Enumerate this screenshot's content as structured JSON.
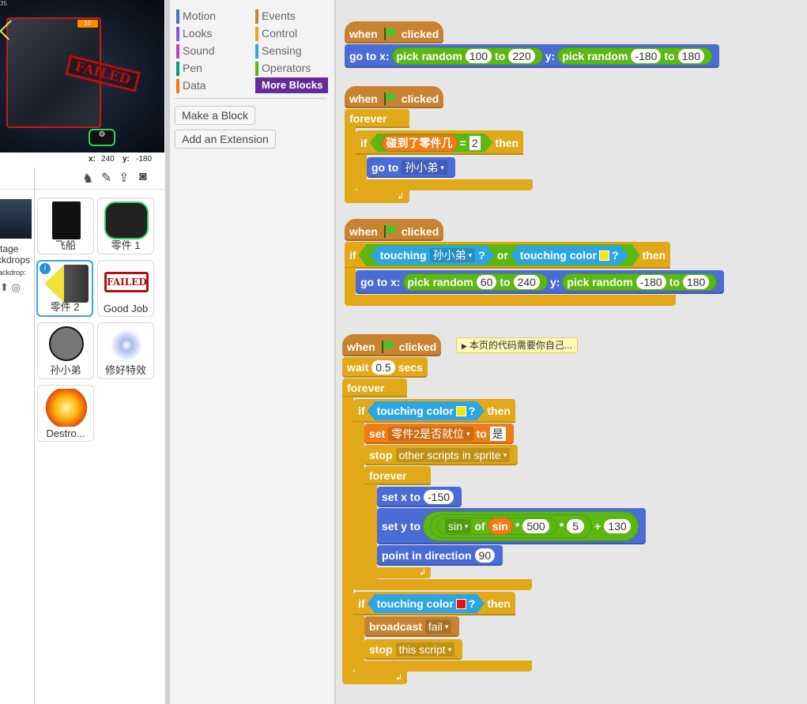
{
  "stage": {
    "counter": "35",
    "hud_value": "10",
    "failed_text": "FAILED",
    "x_label": "x:",
    "x_value": "240",
    "y_label": "y:",
    "y_value": "-180"
  },
  "stage_column": {
    "line1": "tage",
    "line2": "ckdrops",
    "line3": "ackdrop:"
  },
  "sprites": [
    {
      "name": "飞船"
    },
    {
      "name": "零件 1"
    },
    {
      "name": "零件 2"
    },
    {
      "name": "Good Job"
    },
    {
      "name": "孙小弟"
    },
    {
      "name": "修好特效"
    },
    {
      "name": "Destro..."
    }
  ],
  "palette": {
    "categories_left": [
      "Motion",
      "Looks",
      "Sound",
      "Pen",
      "Data"
    ],
    "categories_right": [
      "Events",
      "Control",
      "Sensing",
      "Operators",
      "More Blocks"
    ],
    "colors": {
      "Motion": "#4a6cd4",
      "Looks": "#8a55d7",
      "Sound": "#bb42c3",
      "Pen": "#0e9a6c",
      "Data": "#ee7d16",
      "Events": "#c88330",
      "Control": "#e1a91a",
      "Sensing": "#2ca5e2",
      "Operators": "#5cb712",
      "More Blocks": "#632d99"
    },
    "make_block": "Make a Block",
    "add_extension": "Add an Extension"
  },
  "scripts": {
    "when": "when",
    "clicked": "clicked",
    "go_to_x": "go to x:",
    "y": "y:",
    "pick_random": "pick random",
    "to": "to",
    "s1_a": "100",
    "s1_b": "220",
    "s1_c": "-180",
    "s1_d": "180",
    "forever": "forever",
    "if": "if",
    "then": "then",
    "touched_part": "碰到了零件几",
    "equals": "=",
    "eq_value": "2",
    "go_to": "go to",
    "target_sprite": "孙小弟",
    "touching": "touching",
    "q": "?",
    "or": "or",
    "touching_color": "touching color",
    "s3_a": "60",
    "s3_b": "240",
    "s3_c": "-180",
    "s3_d": "180",
    "note": "本页的代码需要你自己...",
    "wait": "wait",
    "wait_value": "0.5",
    "secs": "secs",
    "set": "set",
    "var_name": "零件2是否就位",
    "set_to": "to",
    "var_value": "是",
    "stop": "stop",
    "stop_option": "other scripts in sprite",
    "set_x_to": "set x to",
    "set_x_value": "-150",
    "set_y_to": "set y to",
    "sin": "sin",
    "of": "of",
    "sin_var": "sin",
    "times1": "*",
    "mult1": "500",
    "times2": "*",
    "mult2": "5",
    "plus": "+",
    "add": "130",
    "point_dir": "point in direction",
    "dir_value": "90",
    "broadcast": "broadcast",
    "broadcast_msg": "fail",
    "stop2_option": "this script",
    "yellow": "#f5e60a",
    "red": "#e81010"
  }
}
